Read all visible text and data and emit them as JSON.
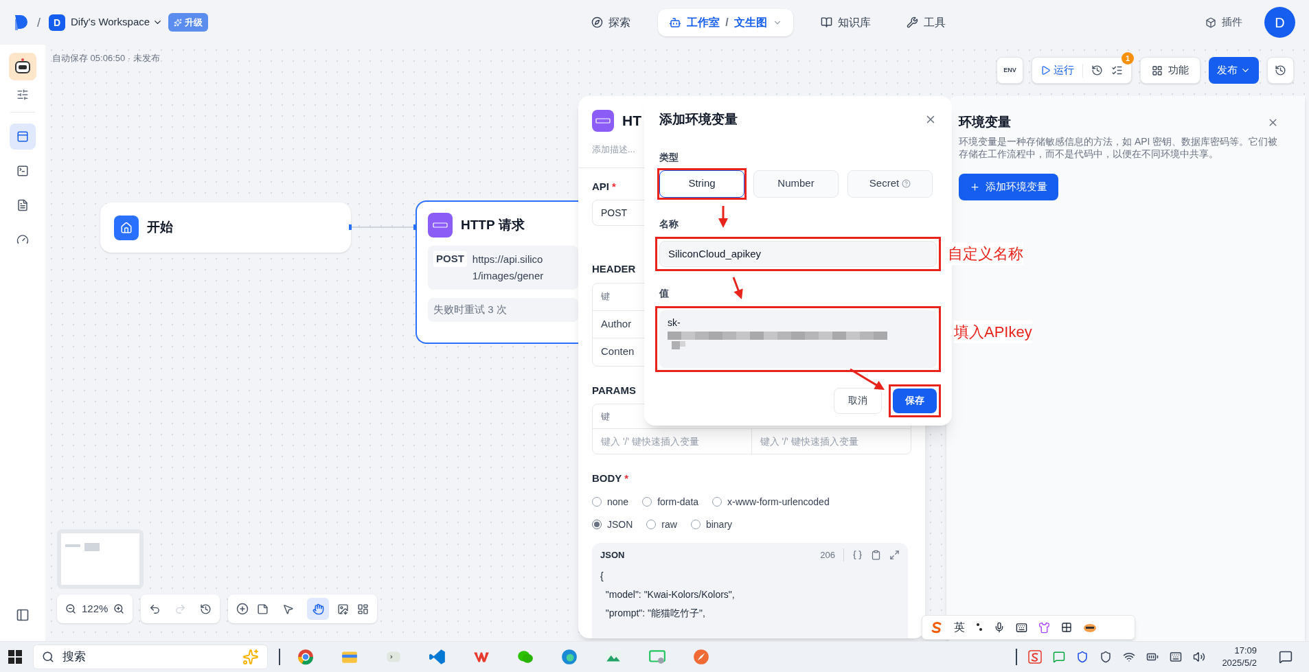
{
  "topbar": {
    "separator": "/",
    "workspace_initial": "D",
    "workspace": "Dify's Workspace",
    "upgrade": "升级",
    "nav": [
      {
        "label": "探索",
        "selected": false
      },
      {
        "label": "工作室",
        "selected": true,
        "separator": "/",
        "sub": "文生图"
      },
      {
        "label": "知识库",
        "selected": false
      },
      {
        "label": "工具",
        "selected": false
      }
    ],
    "plugins": "插件",
    "avatar": "D"
  },
  "sidebar": {
    "items": [
      {
        "selected": true
      },
      {
        "selected": false
      },
      {
        "selected": false
      },
      {
        "selected": false
      }
    ]
  },
  "canvas": {
    "autosave": "自动保存 05:06:50 · 未发布",
    "env": "ENV",
    "run": "运行",
    "badge": "1",
    "features": "功能",
    "publish": "发布",
    "zoom": "122%",
    "tools": [
      {
        "selected": false
      },
      {
        "selected": true
      }
    ]
  },
  "nodes": {
    "start": {
      "title": "开始"
    },
    "http": {
      "title": "HTTP 请求",
      "selected": true,
      "method": "POST",
      "url_lines": [
        "https://api.silico",
        "1/images/gener"
      ],
      "retry": "失败时重试 3 次"
    }
  },
  "http_panel": {
    "title": "HT",
    "description_placeholder": "添加描述...",
    "api_label": "API",
    "required_mark": "*",
    "method": "POST",
    "headers_label": "HEADER",
    "headers_table": {
      "key_header": "键",
      "rows": [
        "Author",
        "Conten"
      ]
    },
    "params_label": "PARAMS",
    "params_table": {
      "key_header": "键",
      "placeholders": [
        "键入 '/' 键快速插入变量",
        "键入 '/' 键快速插入变量"
      ]
    },
    "body_label": "BODY",
    "body_required_mark": "*",
    "body_options": [
      {
        "label": "none",
        "selected": false
      },
      {
        "label": "form-data",
        "selected": false
      },
      {
        "label": "x-www-form-urlencoded",
        "selected": false
      },
      {
        "label": "JSON",
        "selected": true
      },
      {
        "label": "raw",
        "selected": false
      },
      {
        "label": "binary",
        "selected": false
      }
    ],
    "json_editor": {
      "title": "JSON",
      "count": "206",
      "lines": [
        "{",
        "  \"model\": \"Kwai-Kolors/Kolors\",",
        "  \"prompt\": \"能猫吃竹子\","
      ]
    }
  },
  "modal": {
    "title": "添加环境变量",
    "type_label": "类型",
    "types": [
      {
        "label": "String",
        "selected": true,
        "help": false
      },
      {
        "label": "Number",
        "selected": false,
        "help": false
      },
      {
        "label": "Secret",
        "selected": false,
        "help": true
      }
    ],
    "name_label": "名称",
    "name_value": "SiliconCloud_apikey",
    "value_label": "值",
    "value_text": "sk-",
    "cancel": "取消",
    "save": "保存"
  },
  "env_panel": {
    "title": "环境变量",
    "description": "环境变量是一种存储敏感信息的方法，如 API 密钥、数据库密码等。它们被存储在工作流程中，而不是代码中，以便在不同环境中共享。",
    "add_button": "添加环境变量"
  },
  "annotations": {
    "name_note": "自定义名称",
    "value_note": "填入APIkey"
  },
  "ime": {
    "mode": "英"
  },
  "taskbar": {
    "search": "搜索",
    "time": "17:09",
    "date": "2025/5/2"
  }
}
